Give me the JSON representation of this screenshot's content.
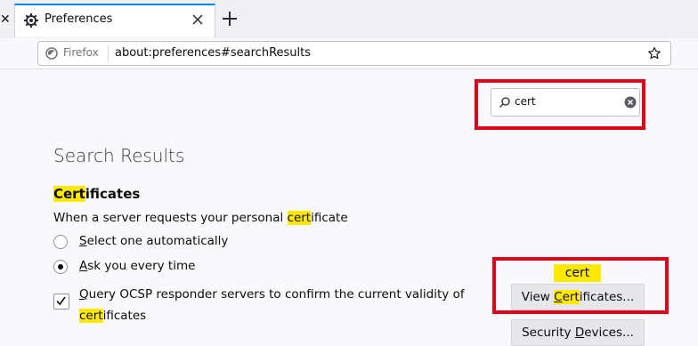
{
  "tabs": [
    {
      "label": "Preferences"
    }
  ],
  "urlbar": {
    "identity": "Firefox",
    "url": "about:preferences#searchResults"
  },
  "search": {
    "value": "cert"
  },
  "results": {
    "title": "Search Results",
    "section": {
      "title_highlight": "Cert",
      "title_rest": "ificates",
      "desc_before": "When a server requests your personal ",
      "desc_highlight": "cert",
      "desc_after": "ificate",
      "radio1": {
        "accesskey": "S",
        "rest": "elect one automatically",
        "checked": false
      },
      "radio2": {
        "accesskey": "A",
        "rest": "sk you every time",
        "checked": true
      },
      "ocsp": {
        "line1": "Query OCSP responder servers to confirm the current validity of",
        "line2_highlight": "cert",
        "line2_rest": "ificates",
        "accesskey": "Q",
        "checked": true
      }
    },
    "tooltip": "cert",
    "buttons": {
      "view_before": "View ",
      "view_highlight_u": "C",
      "view_highlight_rest": "ert",
      "view_after": "ificates...",
      "security_before": "Security ",
      "security_u": "D",
      "security_after": "evices..."
    }
  },
  "colors": {
    "highlight": "#ffe900",
    "annotation": "#e5001a",
    "accent": "#0a84ff"
  },
  "icons": {
    "tab": "gear-icon",
    "tab_close": "close-icon",
    "new_tab": "plus-icon",
    "identity": "firefox-logo-icon",
    "bookmark": "star-icon",
    "search": "search-icon",
    "clear": "clear-icon"
  }
}
